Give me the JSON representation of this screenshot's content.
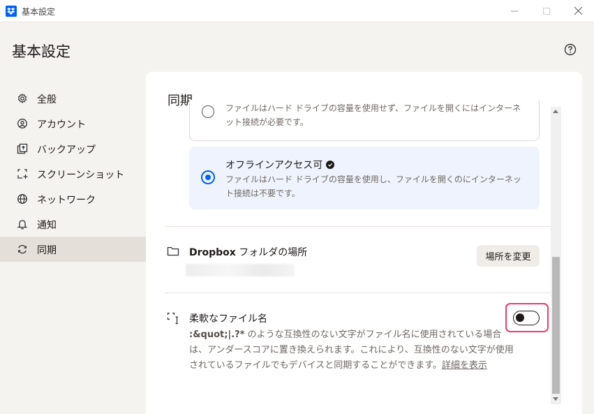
{
  "window": {
    "title": "基本設定"
  },
  "page": {
    "title": "基本設定"
  },
  "sidebar": {
    "items": [
      {
        "label": "全般",
        "icon": "gear-icon"
      },
      {
        "label": "アカウント",
        "icon": "account-icon"
      },
      {
        "label": "バックアップ",
        "icon": "backup-icon"
      },
      {
        "label": "スクリーンショット",
        "icon": "screenshot-icon"
      },
      {
        "label": "ネットワーク",
        "icon": "globe-icon"
      },
      {
        "label": "通知",
        "icon": "bell-icon"
      },
      {
        "label": "同期",
        "icon": "sync-icon",
        "active": true
      }
    ]
  },
  "main": {
    "section_title": "同期",
    "online_only_option": {
      "description": "ファイルはハード ドライブの容量を使用せず、ファイルを開くにはインターネット接続が必要です。",
      "selected": false
    },
    "offline_option": {
      "title": "オフラインアクセス可",
      "description": "ファイルはハード ドライブの容量を使用し、ファイルを開くのにインターネット接続は不要です。",
      "selected": true
    },
    "dropbox_folder": {
      "title_brand": "Dropbox",
      "title_rest": " フォルダの場所",
      "change_button": "場所を変更"
    },
    "flexible_names": {
      "title": "柔軟なファイル名",
      "symbols": ":&quot;|.?*",
      "description": " のような互換性のない文字がファイル名に使用されている場合は、アンダースコアに置き換えられます。これにより、互換性のない文字が使用されているファイルでもデバイスと同期することができます。",
      "details_link": "詳細を表示",
      "enabled": false
    }
  },
  "colors": {
    "accent": "#0061fe",
    "highlight": "#ee3a6a",
    "selected_card_bg": "#eef3fd"
  }
}
